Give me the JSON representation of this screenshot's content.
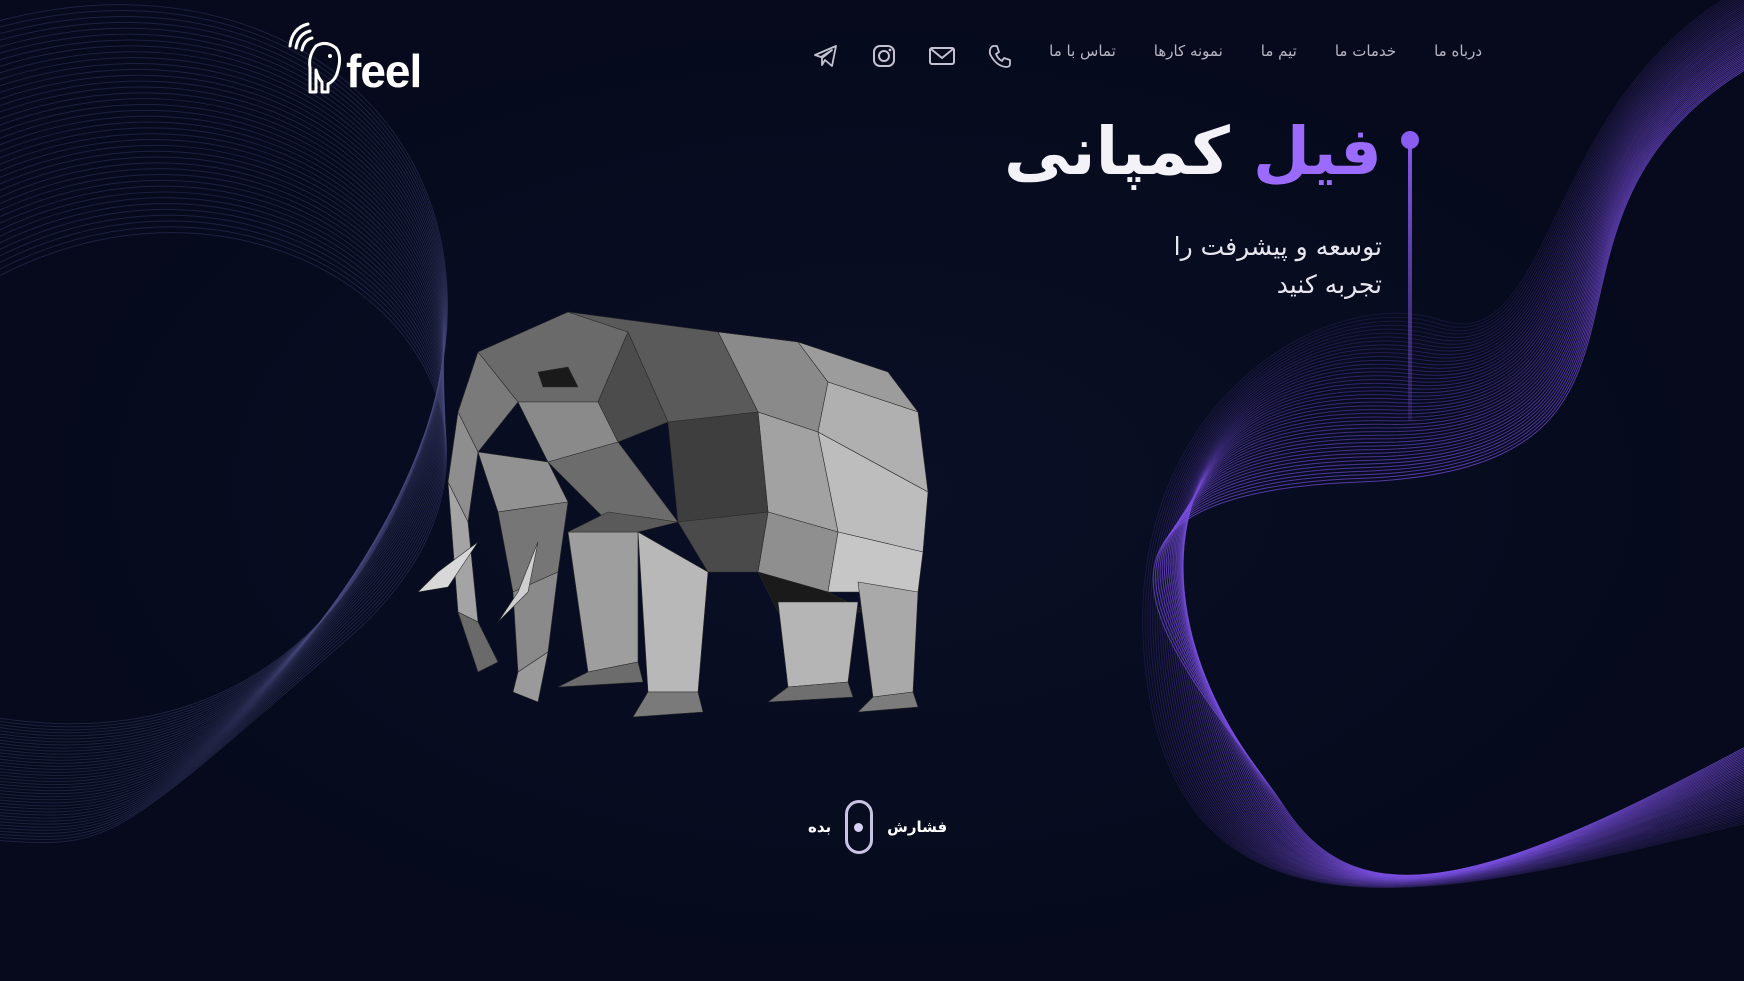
{
  "brand": {
    "logo_text": "feel"
  },
  "nav": {
    "items": [
      {
        "label": "درباه ما"
      },
      {
        "label": "خدمات ما"
      },
      {
        "label": "تیم ما"
      },
      {
        "label": "نمونه کارها"
      },
      {
        "label": "تماس با ما"
      }
    ]
  },
  "social": {
    "icons": [
      "phone-icon",
      "mail-icon",
      "instagram-icon",
      "telegram-icon"
    ]
  },
  "hero": {
    "title_accent": "فیل",
    "title_rest": "کمپانی",
    "subtitle_line1": "توسعه و پیشرفت را",
    "subtitle_line2": "تجربه کنید"
  },
  "press_hint": {
    "left_word": "فشارش",
    "right_word": "بده"
  },
  "colors": {
    "background": "#060a1c",
    "accent": "#9b6bff",
    "wave_purple": "#7a4fe0",
    "nav_text": "#b8b6c4"
  }
}
